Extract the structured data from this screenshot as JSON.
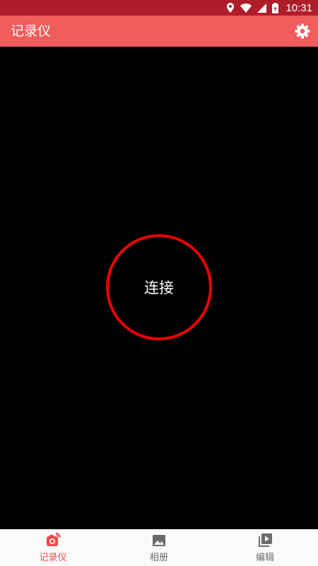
{
  "status_bar": {
    "time": "10:31",
    "icons": [
      "location-icon",
      "wifi-icon",
      "signal-icon",
      "battery-icon"
    ]
  },
  "app_bar": {
    "title": "记录仪",
    "settings_icon": "gear-icon"
  },
  "main": {
    "connect_label": "连接"
  },
  "bottom_nav": {
    "items": [
      {
        "label": "记录仪",
        "icon": "camera-icon",
        "active": true
      },
      {
        "label": "相册",
        "icon": "image-icon",
        "active": false
      },
      {
        "label": "编辑",
        "icon": "video-library-icon",
        "active": false
      }
    ]
  },
  "colors": {
    "status_bar": "#b01d2a",
    "app_bar": "#f15c5c",
    "accent": "#f04a4a",
    "connect_ring": "#ee0000",
    "background": "#000000"
  }
}
